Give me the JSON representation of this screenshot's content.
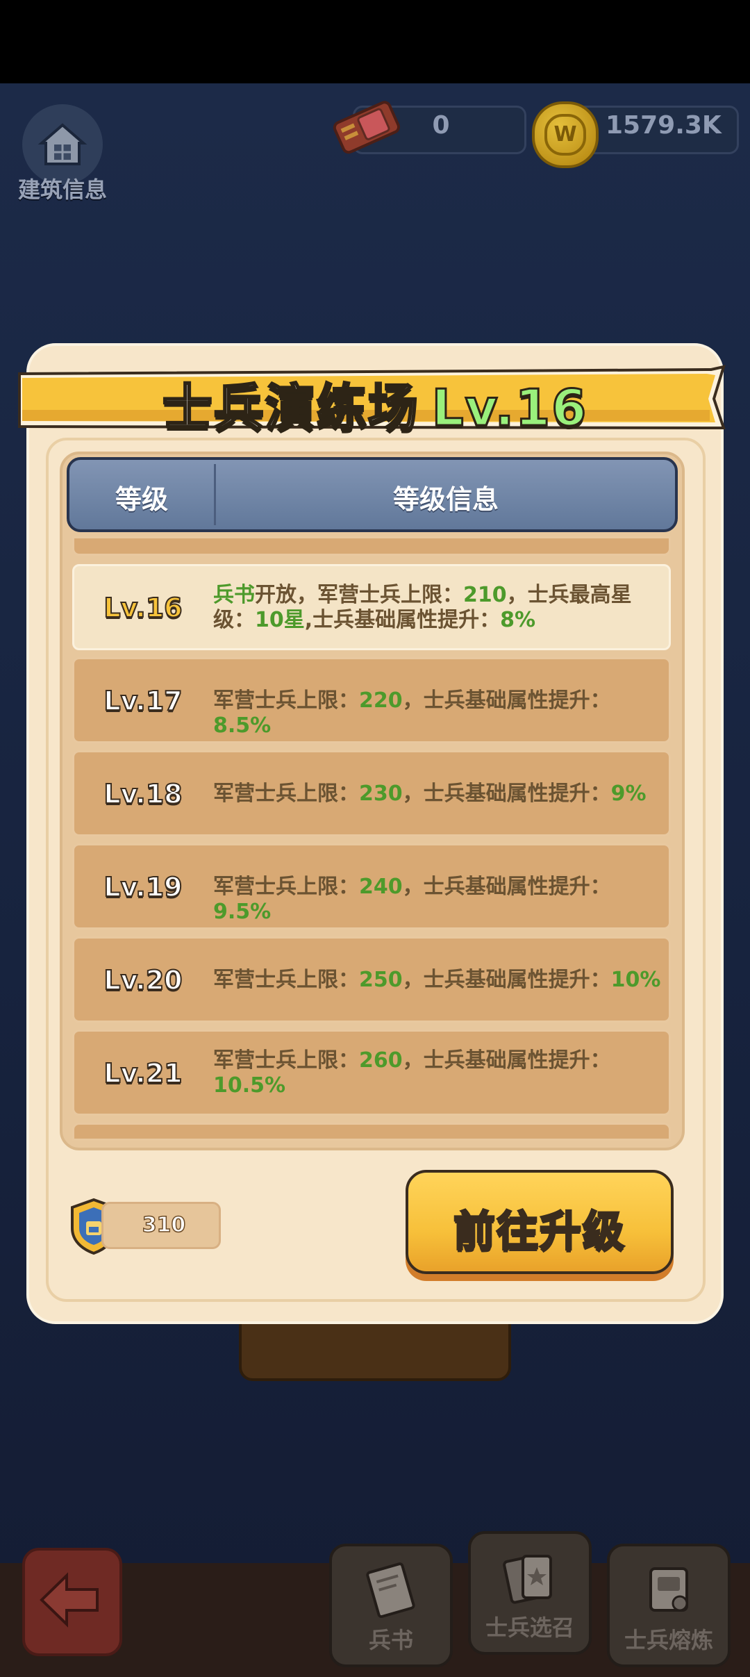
{
  "hud": {
    "building_info_label": "建筑信息",
    "tickets_value": "0",
    "coins_value": "1579.3K"
  },
  "modal": {
    "title": "士兵演练场",
    "title_level": "Lv.16",
    "header_level": "等级",
    "header_info": "等级信息",
    "rows": [
      {
        "level": "Lv.16",
        "current": true,
        "info_parts": [
          {
            "text": "兵书",
            "green": true
          },
          {
            "text": "开放，军营士兵上限：",
            "green": false
          },
          {
            "text": "210",
            "green": true
          },
          {
            "text": "，士兵最高星级：",
            "green": false
          },
          {
            "text": "10星",
            "green": true
          },
          {
            "text": ",士兵基础属性提升：",
            "green": false
          },
          {
            "text": "8%",
            "green": true
          }
        ]
      },
      {
        "level": "Lv.17",
        "current": false,
        "info_parts": [
          {
            "text": "军营士兵上限：",
            "green": false
          },
          {
            "text": "220",
            "green": true
          },
          {
            "text": "，士兵基础属性提升：",
            "green": false
          },
          {
            "text": "8.5%",
            "green": true
          }
        ]
      },
      {
        "level": "Lv.18",
        "current": false,
        "info_parts": [
          {
            "text": "军营士兵上限：",
            "green": false
          },
          {
            "text": "230",
            "green": true
          },
          {
            "text": "，士兵基础属性提升：",
            "green": false
          },
          {
            "text": "9%",
            "green": true
          }
        ]
      },
      {
        "level": "Lv.19",
        "current": false,
        "info_parts": [
          {
            "text": "军营士兵上限：",
            "green": false
          },
          {
            "text": "240",
            "green": true
          },
          {
            "text": "，士兵基础属性提升：",
            "green": false
          },
          {
            "text": "9.5%",
            "green": true
          }
        ]
      },
      {
        "level": "Lv.20",
        "current": false,
        "info_parts": [
          {
            "text": "军营士兵上限：",
            "green": false
          },
          {
            "text": "250",
            "green": true
          },
          {
            "text": "，士兵基础属性提升：",
            "green": false
          },
          {
            "text": "10%",
            "green": true
          }
        ]
      },
      {
        "level": "Lv.21",
        "current": false,
        "info_parts": [
          {
            "text": "军营士兵上限：",
            "green": false
          },
          {
            "text": "260",
            "green": true
          },
          {
            "text": "，士兵基础属性提升：",
            "green": false
          },
          {
            "text": "10.5%",
            "green": true
          }
        ]
      }
    ],
    "cost_value": "310",
    "upgrade_button": "前往升级"
  },
  "bottom_nav": {
    "book_label": "兵书",
    "recruit_label": "士兵选召",
    "smelt_label": "士兵熔炼"
  },
  "colors": {
    "green_value": "#4d9a2b",
    "ribbon": "#f7c33b",
    "title_level": "#9af07c"
  }
}
